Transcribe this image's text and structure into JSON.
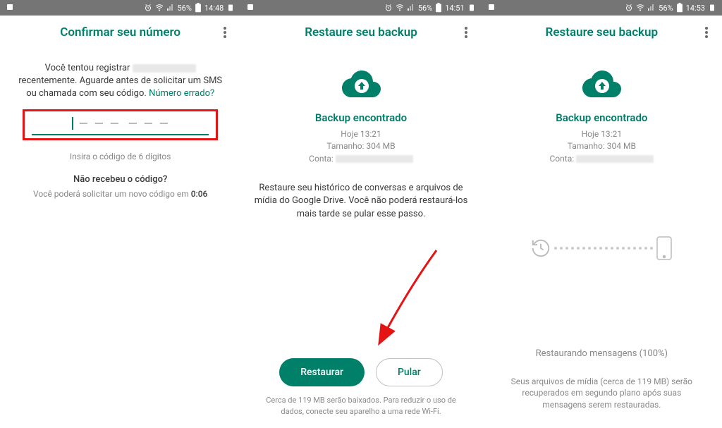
{
  "status_bar": {
    "battery_percent": "56%",
    "time_1": "14:48",
    "time_2": "14:51",
    "time_3": "14:53"
  },
  "screen1": {
    "title": "Confirmar seu número",
    "text_before": "Você tentou registrar",
    "text_after": "recentemente. Aguarde antes de solicitar um SMS ou chamada com seu código.",
    "wrong_number": "Número errado?",
    "code_hint": "Insira o código de 6 dígitos",
    "no_code_title": "Não recebeu o código?",
    "wait_text": "Você poderá solicitar um novo código em",
    "timer": "0:06"
  },
  "screen2": {
    "title": "Restaure seu backup",
    "backup_found": "Backup encontrado",
    "backup_time": "Hoje 13:21",
    "backup_size": "Tamanho: 304 MB",
    "account_label": "Conta:",
    "restore_desc": "Restaure seu histórico de conversas e arquivos de mídia do Google Drive. Você não poderá restaurá-los mais tarde se pular esse passo.",
    "btn_restore": "Restaurar",
    "btn_skip": "Pular",
    "footer_note": "Cerca de 119 MB serão baixados. Para reduzir o uso de dados, conecte seu aparelho a uma rede Wi-Fi."
  },
  "screen3": {
    "title": "Restaure seu backup",
    "backup_found": "Backup encontrado",
    "backup_time": "Hoje 13:21",
    "backup_size": "Tamanho: 304 MB",
    "account_label": "Conta:",
    "progress_status": "Restaurando mensagens (100%)",
    "media_text": "Seus arquivos de mídia (cerca de 119 MB) serão recuperados em segundo plano após suas mensagens serem restauradas."
  }
}
